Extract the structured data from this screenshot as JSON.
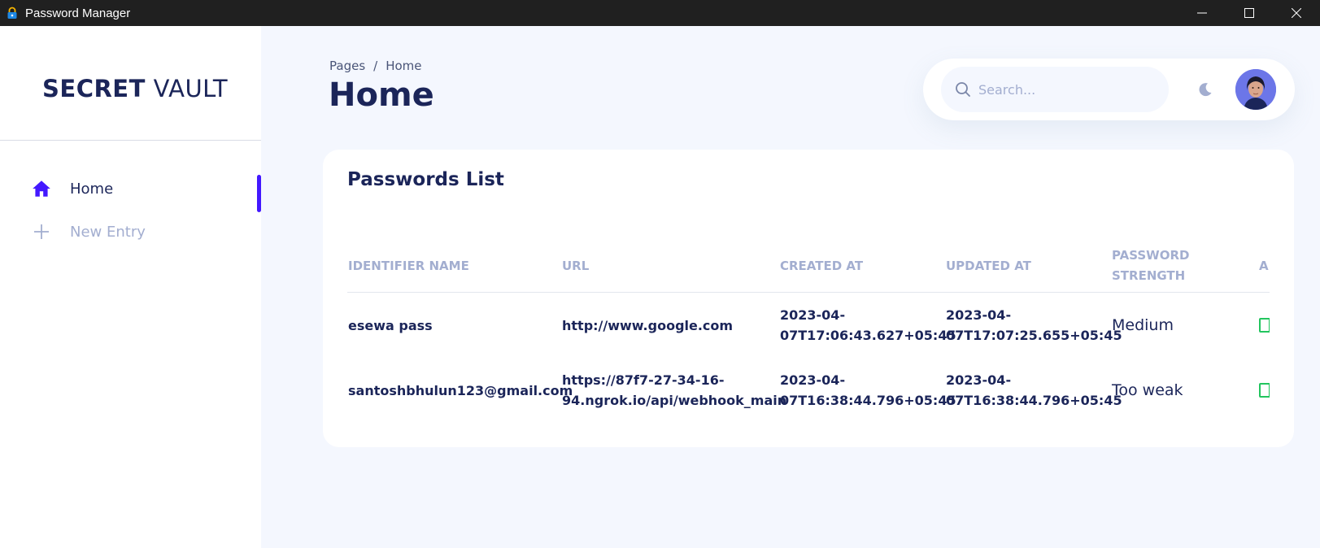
{
  "window": {
    "title": "Password Manager",
    "icon": "lock-icon",
    "controls": [
      "minimize-icon",
      "maximize-icon",
      "close-icon"
    ]
  },
  "sidebar": {
    "brand_bold": "SECRET",
    "brand_light": "VAULT",
    "items": [
      {
        "label": "Home",
        "icon": "home-icon",
        "active": true
      },
      {
        "label": "New Entry",
        "icon": "plus-icon",
        "active": false
      }
    ]
  },
  "header": {
    "breadcrumb": [
      "Pages",
      "/",
      "Home"
    ],
    "title": "Home",
    "search_placeholder": "Search...",
    "theme_icon": "moon-icon"
  },
  "card": {
    "title": "Passwords List",
    "columns": [
      "IDENTIFIER NAME",
      "URL",
      "CREATED AT",
      "UPDATED AT",
      "PASSWORD STRENGTH",
      "A"
    ],
    "rows": [
      {
        "identifier": "esewa pass",
        "url": "http://www.google.com",
        "created_at": "2023-04-07T17:06:43.627+05:45",
        "updated_at": "2023-04-07T17:07:25.655+05:45",
        "strength": "Medium"
      },
      {
        "identifier": "santoshbhulun123@gmail.com",
        "url": "https://87f7-27-34-16-94.ngrok.io/api/webhook_main",
        "created_at": "2023-04-07T16:38:44.796+05:45",
        "updated_at": "2023-04-07T16:38:44.796+05:45",
        "strength": "Too weak"
      }
    ]
  },
  "colors": {
    "accent": "#4318FF",
    "navy": "#1B2559",
    "muted": "#A3AED0",
    "background": "#F4F7FE",
    "action": "#22C55E"
  }
}
